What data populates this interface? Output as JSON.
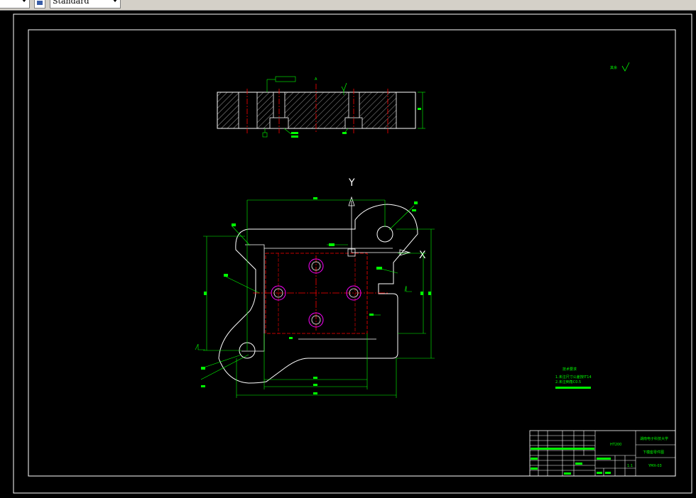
{
  "toolbar": {
    "layer_combo_value": "",
    "style_combo_value": "Standard"
  },
  "drawing": {
    "roughness_note": "其余",
    "axis_y": "Y",
    "axis_x": "X",
    "section_labels": [
      "A",
      "A"
    ],
    "tech_requirements_title": "技术要求",
    "tech_requirements_lines": [
      "1.未注尺寸公差按IT14",
      "2.未注倒角C0.5"
    ],
    "title_block": {
      "school": "湖南电子科技大学",
      "part_name": "下模座零件图",
      "drawing_no": "YMX-03",
      "material": "HT200",
      "scale": "1:1"
    }
  },
  "colors": {
    "outline": "#ffffff",
    "dimension": "#00ff00",
    "centerline": "#ff0000",
    "hole": "#ff00ff",
    "background": "#000000"
  }
}
